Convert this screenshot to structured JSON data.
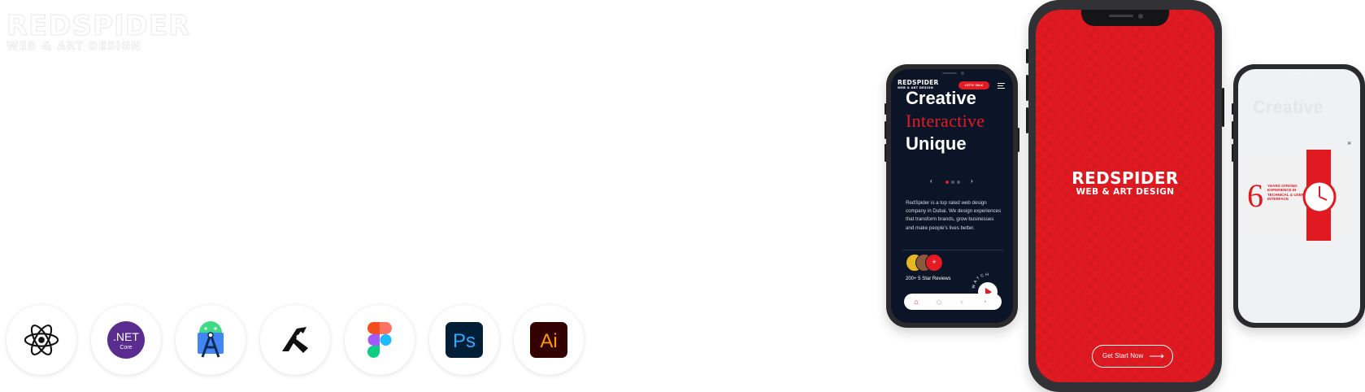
{
  "brand": {
    "name": "REDSPIDER",
    "tagline": "WEB & ART DESIGN"
  },
  "tech_icons": [
    {
      "name": "react-icon"
    },
    {
      "name": "dotnet-core-icon",
      "label": ".NET",
      "sublabel": "Core"
    },
    {
      "name": "android-studio-icon"
    },
    {
      "name": "xd-sketch-icon"
    },
    {
      "name": "figma-icon"
    },
    {
      "name": "photoshop-icon",
      "label": "Ps"
    },
    {
      "name": "illustrator-icon",
      "label": "Ai"
    }
  ],
  "left_phone": {
    "logo_main": "REDSPIDER",
    "logo_sub": "WEB & ART DESIGN",
    "cta": "LET'S TALK",
    "headline_1": "Creative",
    "headline_2": "Interactive",
    "headline_3": "Unique",
    "slider_prev": "‹",
    "slider_next": "›",
    "body": "RedSpider is a top rated web design company in Dubai. We design experiences that transform brands, grow businesses and make people's lives better.",
    "reviews": "200+ 5 Star Reviews",
    "watch_label": "WATCH"
  },
  "center_phone": {
    "logo_main": "REDSPIDER",
    "logo_sub": "WEB & ART DESIGN",
    "button": "Get Start Now",
    "button_arrow": "⟶"
  },
  "right_phone": {
    "faint_headline": "Creative",
    "close": "×",
    "years_number": "6",
    "years_text": "YEARS STRONG EXPERIENCE IN TECHNICAL & USER INTERFACE"
  },
  "colors": {
    "brand_red": "#e11a22",
    "dark_navy": "#0b1527"
  }
}
